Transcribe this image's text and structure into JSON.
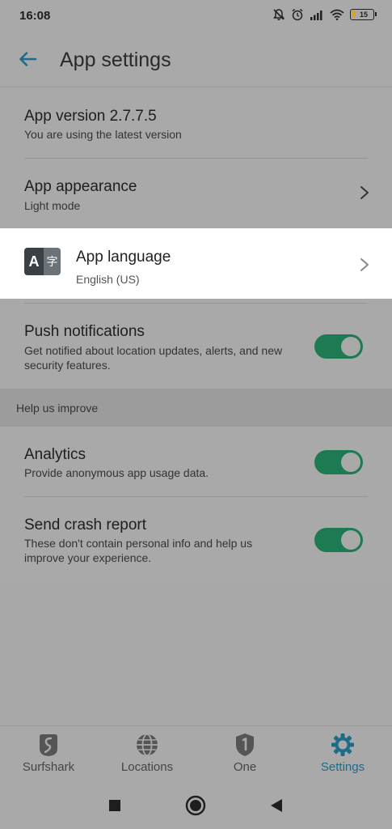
{
  "status_bar": {
    "time": "16:08",
    "battery": "15",
    "icons": [
      "bell-off-icon",
      "alarm-icon",
      "signal-icon",
      "wifi-icon",
      "battery-icon"
    ]
  },
  "header": {
    "title": "App settings",
    "back_icon": "arrow-left-icon"
  },
  "settings": {
    "version": {
      "title": "App version 2.7.7.5",
      "subtitle": "You are using the latest version"
    },
    "appearance": {
      "title": "App appearance",
      "subtitle": "Light mode"
    },
    "language": {
      "title": "App language",
      "subtitle": "English (US)",
      "icon_letter_a": "A",
      "icon_letter_b": "字"
    },
    "push": {
      "title": "Push notifications",
      "subtitle": "Get notified about location updates, alerts, and new security features.",
      "enabled": true
    },
    "help_header": "Help us improve",
    "analytics": {
      "title": "Analytics",
      "subtitle": "Provide anonymous app usage data.",
      "enabled": true
    },
    "crash": {
      "title": "Send crash report",
      "subtitle": "These don't contain personal info and help us improve your experience.",
      "enabled": true
    }
  },
  "bottom_nav": {
    "items": [
      {
        "label": "Surfshark",
        "icon": "surfshark-logo-icon",
        "active": false
      },
      {
        "label": "Locations",
        "icon": "globe-icon",
        "active": false
      },
      {
        "label": "One",
        "icon": "one-shield-icon",
        "active": false
      },
      {
        "label": "Settings",
        "icon": "gear-icon",
        "active": true
      }
    ]
  },
  "colors": {
    "accent": "#1c6c8a",
    "toggle_on": "#1d7a52",
    "overlay_gray": "#a9a9a9",
    "highlight_card": "#ffffff"
  }
}
